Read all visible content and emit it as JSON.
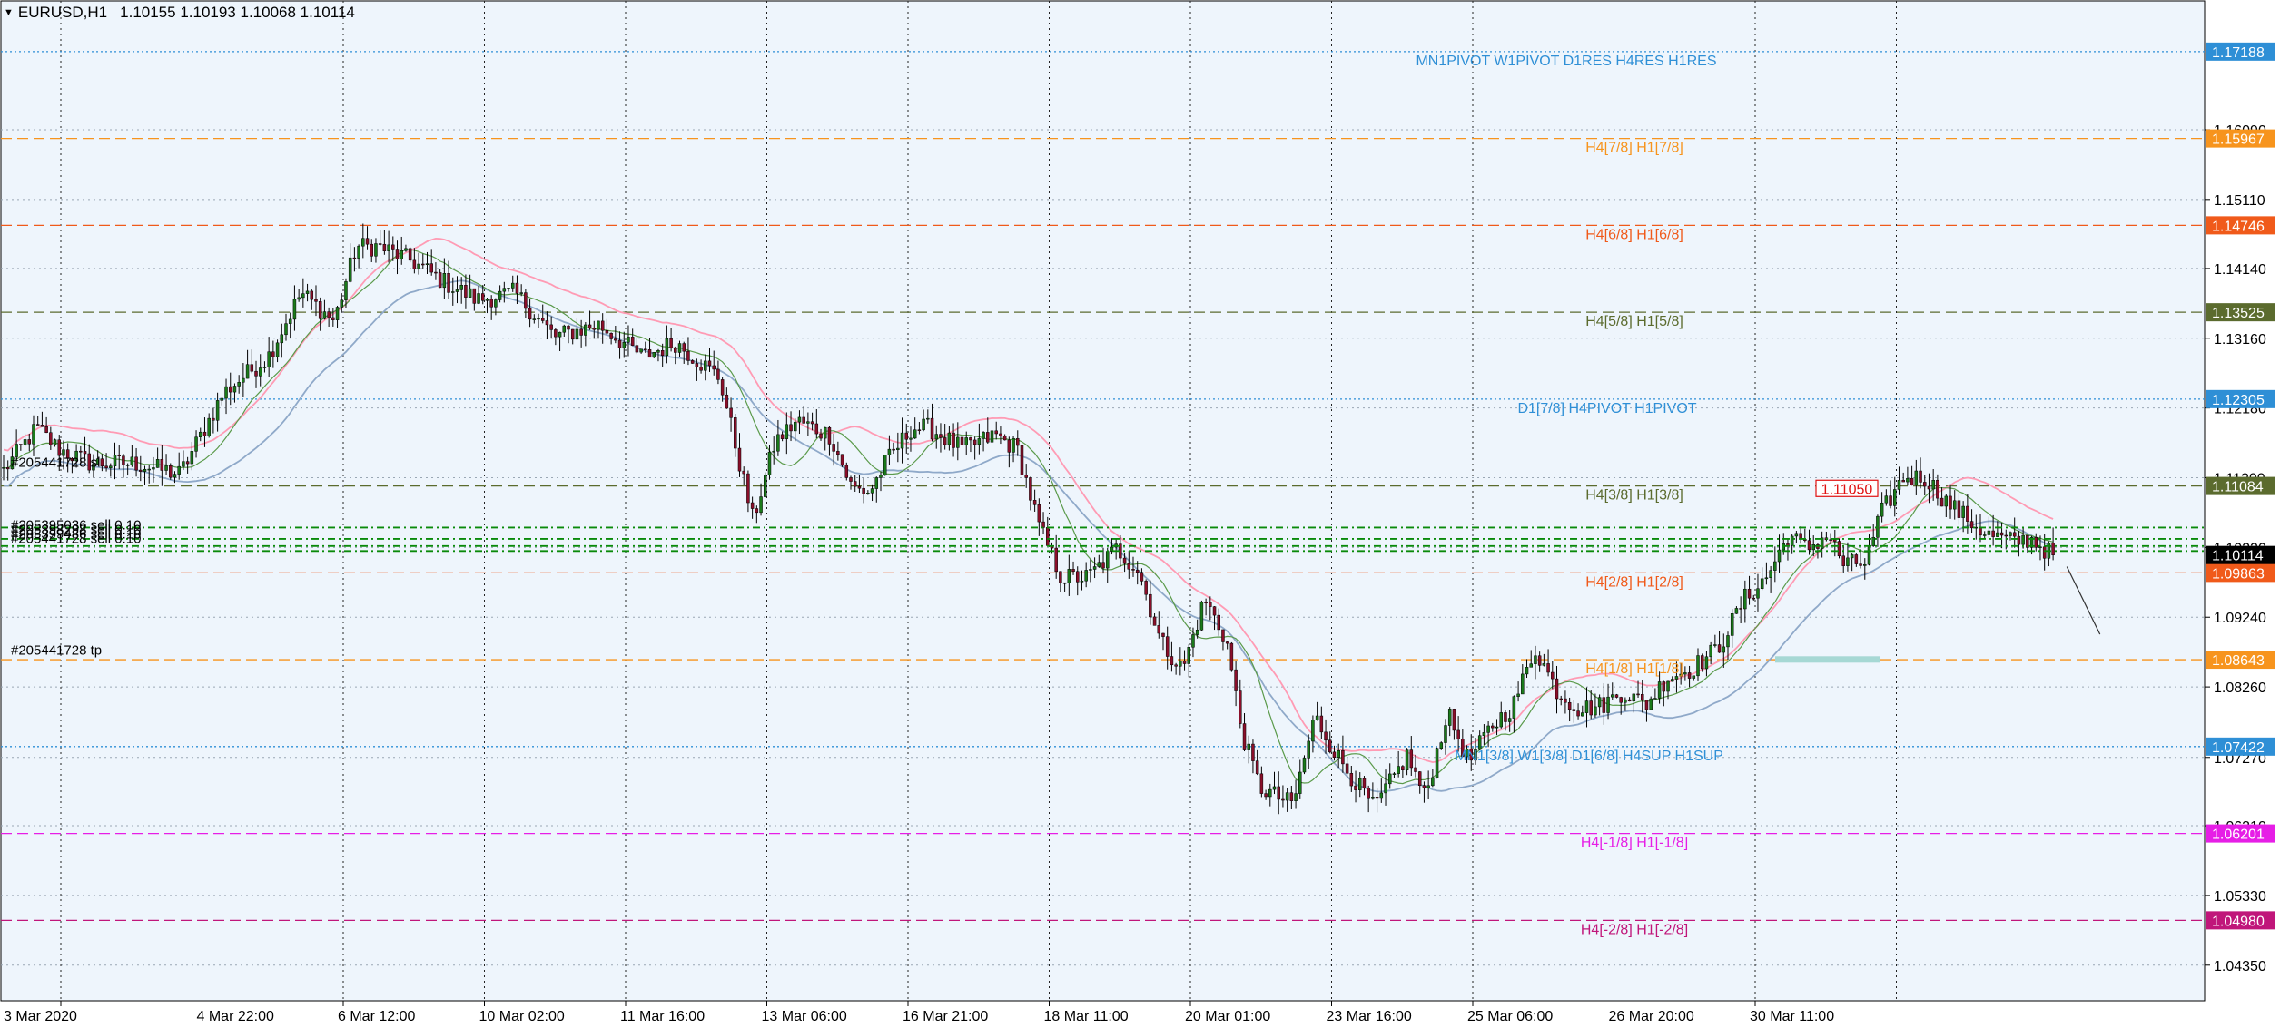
{
  "header": {
    "symbol_label": "EURUSD,H1",
    "ohlc": "1.10155 1.10193 1.10068 1.10114"
  },
  "chart_data": {
    "type": "candlestick",
    "symbol": "EURUSD",
    "timeframe": "H1",
    "ylim": [
      1.0385,
      1.179
    ],
    "background": "#eef5fc",
    "up_color": "#1a7a1a",
    "down_color": "#8a0f2a",
    "ma_colors": {
      "green": "#5a9a4a",
      "blue": "#8fa9c9",
      "pink": "#ff9bb4"
    },
    "price_ticks": [
      "1.16090",
      "1.15110",
      "1.14140",
      "1.13160",
      "1.12180",
      "1.11200",
      "1.10220",
      "1.09240",
      "1.08260",
      "1.07270",
      "1.06310",
      "1.05330",
      "1.04350"
    ],
    "x_ticks": [
      "3 Mar 2020",
      "4 Mar 22:00",
      "6 Mar 12:00",
      "10 Mar 02:00",
      "11 Mar 16:00",
      "13 Mar 06:00",
      "16 Mar 21:00",
      "18 Mar 11:00",
      "20 Mar 01:00",
      "23 Mar 16:00",
      "25 Mar 06:00",
      "26 Mar 20:00",
      "30 Mar 11:00"
    ],
    "levels": [
      {
        "price": 1.17188,
        "label": "MN1PIVOT W1PIVOT D1RES H4RES H1RES",
        "color": "#2e8fd6",
        "style": "dotted",
        "tag": "1.17188"
      },
      {
        "price": 1.15967,
        "label": "H4[7/8] H1[7/8]",
        "color": "#f7941d",
        "style": "dashed",
        "tag": "1.15967"
      },
      {
        "price": 1.14746,
        "label": "H4[6/8] H1[6/8]",
        "color": "#f05a1a",
        "style": "dashed",
        "tag": "1.14746"
      },
      {
        "price": 1.13525,
        "label": "H4[5/8] H1[5/8]",
        "color": "#5b6b2e",
        "style": "dashed",
        "tag": "1.13525"
      },
      {
        "price": 1.12305,
        "label": "D1[7/8] H4PIVOT H1PIVOT",
        "color": "#2e8fd6",
        "style": "dotted",
        "tag": "1.12305"
      },
      {
        "price": 1.11084,
        "label": "H4[3/8] H1[3/8]",
        "color": "#5b6b2e",
        "style": "dashed",
        "tag": "1.11084"
      },
      {
        "price": 1.09863,
        "label": "H4[2/8] H1[2/8]",
        "color": "#f05a1a",
        "style": "dashed",
        "tag": "1.09863"
      },
      {
        "price": 1.08643,
        "label": "H4[1/8] H1[1/8]",
        "color": "#f7941d",
        "style": "dashed",
        "tag": "1.08643"
      },
      {
        "price": 1.07422,
        "label": "MN1[3/8] W1[3/8] D1[6/8] H4SUP H1SUP",
        "color": "#2e8fd6",
        "style": "dotted",
        "tag": "1.07422"
      },
      {
        "price": 1.06201,
        "label": "H4[-1/8] H1[-1/8]",
        "color": "#e61ee6",
        "style": "dashed",
        "tag": "1.06201"
      },
      {
        "price": 1.0498,
        "label": "H4[-2/8] H1[-2/8]",
        "color": "#c0167a",
        "style": "dashed",
        "tag": "1.04980"
      }
    ],
    "current_price": {
      "value": 1.10114,
      "tag": "1.10114"
    },
    "price_alert": {
      "value": 1.1105,
      "label": "1.11050"
    },
    "orders": [
      {
        "label": "#205395036 sell 0.10",
        "price": 1.105
      },
      {
        "label": "#205398298 sell 0.10",
        "price": 1.1034
      },
      {
        "label": "#205399486 sell 0.10",
        "price": 1.1024
      },
      {
        "label": "#205441728 sell 0.10",
        "price": 1.1017
      }
    ],
    "order_tags": {
      "upper": "#205441728 sl",
      "tp": "#205441728 tp"
    },
    "tp_price": 1.0864,
    "projection": {
      "from_x": 0.9375,
      "from": 1.0995,
      "to_x": 0.9525,
      "to": 1.09
    },
    "anchors": [
      [
        0.0,
        1.113
      ],
      [
        0.015,
        1.119
      ],
      [
        0.025,
        1.116
      ],
      [
        0.04,
        1.114
      ],
      [
        0.06,
        1.114
      ],
      [
        0.08,
        1.1125
      ],
      [
        0.1,
        1.124
      ],
      [
        0.12,
        1.129
      ],
      [
        0.135,
        1.138
      ],
      [
        0.15,
        1.134
      ],
      [
        0.16,
        1.1445
      ],
      [
        0.17,
        1.1445
      ],
      [
        0.185,
        1.1425
      ],
      [
        0.2,
        1.1395
      ],
      [
        0.215,
        1.137
      ],
      [
        0.232,
        1.138
      ],
      [
        0.25,
        1.1318
      ],
      [
        0.27,
        1.1335
      ],
      [
        0.29,
        1.129
      ],
      [
        0.305,
        1.131
      ],
      [
        0.325,
        1.126
      ],
      [
        0.34,
        1.106
      ],
      [
        0.35,
        1.117
      ],
      [
        0.36,
        1.12
      ],
      [
        0.375,
        1.118
      ],
      [
        0.385,
        1.1105
      ],
      [
        0.393,
        1.11
      ],
      [
        0.4,
        1.114
      ],
      [
        0.412,
        1.119
      ],
      [
        0.42,
        1.119
      ],
      [
        0.435,
        1.116
      ],
      [
        0.45,
        1.118
      ],
      [
        0.46,
        1.116
      ],
      [
        0.47,
        1.105
      ],
      [
        0.48,
        1.098
      ],
      [
        0.492,
        1.098
      ],
      [
        0.505,
        1.102
      ],
      [
        0.515,
        1.099
      ],
      [
        0.525,
        1.089
      ],
      [
        0.535,
        1.085
      ],
      [
        0.545,
        1.095
      ],
      [
        0.555,
        1.089
      ],
      [
        0.562,
        1.076
      ],
      [
        0.57,
        1.0685
      ],
      [
        0.585,
        1.066
      ],
      [
        0.595,
        1.0785
      ],
      [
        0.605,
        1.073
      ],
      [
        0.622,
        1.0655
      ],
      [
        0.637,
        1.073
      ],
      [
        0.645,
        1.067
      ],
      [
        0.655,
        1.079
      ],
      [
        0.665,
        1.072
      ],
      [
        0.675,
        1.077
      ],
      [
        0.685,
        1.08
      ],
      [
        0.695,
        1.088
      ],
      [
        0.705,
        1.082
      ],
      [
        0.715,
        1.0795
      ],
      [
        0.725,
        1.08
      ],
      [
        0.735,
        1.082
      ],
      [
        0.745,
        1.08
      ],
      [
        0.755,
        1.084
      ],
      [
        0.765,
        1.085
      ],
      [
        0.778,
        1.088
      ],
      [
        0.79,
        1.095
      ],
      [
        0.8,
        1.098
      ],
      [
        0.81,
        1.104
      ],
      [
        0.818,
        1.102
      ],
      [
        0.828,
        1.104
      ],
      [
        0.835,
        1.0998
      ],
      [
        0.845,
        1.1
      ],
      [
        0.852,
        1.107
      ],
      [
        0.862,
        1.112
      ],
      [
        0.872,
        1.112
      ],
      [
        0.882,
        1.1085
      ],
      [
        0.892,
        1.106
      ],
      [
        0.9,
        1.104
      ],
      [
        0.912,
        1.103
      ],
      [
        0.92,
        1.1034
      ],
      [
        0.93,
        1.1011
      ]
    ]
  }
}
